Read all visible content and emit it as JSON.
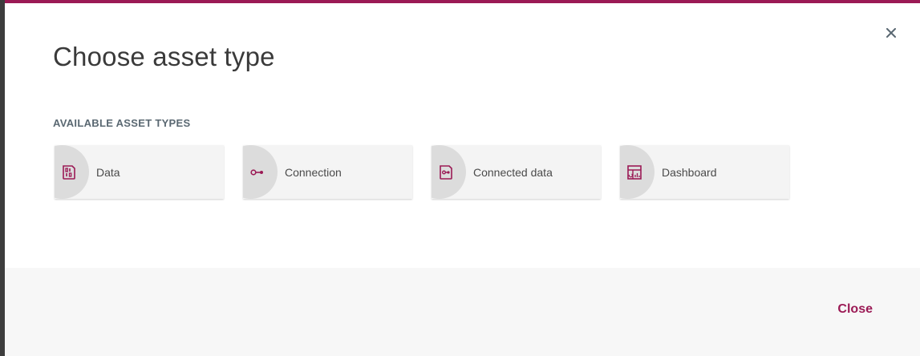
{
  "dialog": {
    "title": "Choose asset type",
    "section_label": "AVAILABLE ASSET TYPES",
    "close_label": "Close",
    "accent_color": "#9b1a55"
  },
  "asset_types": [
    {
      "label": "Data",
      "icon": "data-icon"
    },
    {
      "label": "Connection",
      "icon": "connection-icon"
    },
    {
      "label": "Connected data",
      "icon": "connected-data-icon"
    },
    {
      "label": "Dashboard",
      "icon": "dashboard-icon"
    }
  ]
}
